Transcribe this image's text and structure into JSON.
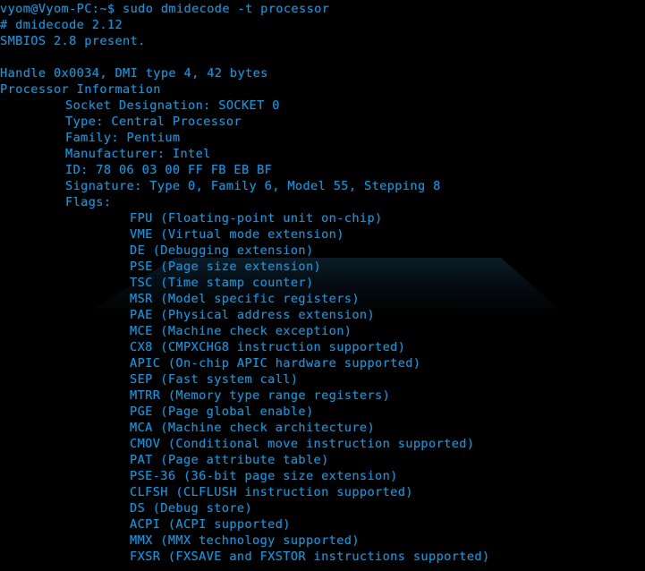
{
  "terminal": {
    "shell_prompt": "vyom@Vyom-PC:~$",
    "command": "sudo dmidecode -t processor",
    "user": "vyom",
    "host": "Vyom-PC",
    "cwd": "~",
    "colors": {
      "background": "#000000",
      "foreground": "#1e90d6"
    },
    "lines": [
      {
        "indent": 0,
        "text": "vyom@Vyom-PC:~$ sudo dmidecode -t processor"
      },
      {
        "indent": 0,
        "text": "# dmidecode 2.12"
      },
      {
        "indent": 0,
        "text": "SMBIOS 2.8 present."
      },
      {
        "indent": 0,
        "text": ""
      },
      {
        "indent": 0,
        "text": "Handle 0x0034, DMI type 4, 42 bytes"
      },
      {
        "indent": 0,
        "text": "Processor Information"
      },
      {
        "indent": 1,
        "text": "Socket Designation: SOCKET 0"
      },
      {
        "indent": 1,
        "text": "Type: Central Processor"
      },
      {
        "indent": 1,
        "text": "Family: Pentium"
      },
      {
        "indent": 1,
        "text": "Manufacturer: Intel"
      },
      {
        "indent": 1,
        "text": "ID: 78 06 03 00 FF FB EB BF"
      },
      {
        "indent": 1,
        "text": "Signature: Type 0, Family 6, Model 55, Stepping 8"
      },
      {
        "indent": 1,
        "text": "Flags:"
      },
      {
        "indent": 2,
        "text": "FPU (Floating-point unit on-chip)"
      },
      {
        "indent": 2,
        "text": "VME (Virtual mode extension)"
      },
      {
        "indent": 2,
        "text": "DE (Debugging extension)"
      },
      {
        "indent": 2,
        "text": "PSE (Page size extension)"
      },
      {
        "indent": 2,
        "text": "TSC (Time stamp counter)"
      },
      {
        "indent": 2,
        "text": "MSR (Model specific registers)"
      },
      {
        "indent": 2,
        "text": "PAE (Physical address extension)"
      },
      {
        "indent": 2,
        "text": "MCE (Machine check exception)"
      },
      {
        "indent": 2,
        "text": "CX8 (CMPXCHG8 instruction supported)"
      },
      {
        "indent": 2,
        "text": "APIC (On-chip APIC hardware supported)"
      },
      {
        "indent": 2,
        "text": "SEP (Fast system call)"
      },
      {
        "indent": 2,
        "text": "MTRR (Memory type range registers)"
      },
      {
        "indent": 2,
        "text": "PGE (Page global enable)"
      },
      {
        "indent": 2,
        "text": "MCA (Machine check architecture)"
      },
      {
        "indent": 2,
        "text": "CMOV (Conditional move instruction supported)"
      },
      {
        "indent": 2,
        "text": "PAT (Page attribute table)"
      },
      {
        "indent": 2,
        "text": "PSE-36 (36-bit page size extension)"
      },
      {
        "indent": 2,
        "text": "CLFSH (CLFLUSH instruction supported)"
      },
      {
        "indent": 2,
        "text": "DS (Debug store)"
      },
      {
        "indent": 2,
        "text": "ACPI (ACPI supported)"
      },
      {
        "indent": 2,
        "text": "MMX (MMX technology supported)"
      },
      {
        "indent": 2,
        "text": "FXSR (FXSAVE and FXSTOR instructions supported)"
      }
    ]
  }
}
